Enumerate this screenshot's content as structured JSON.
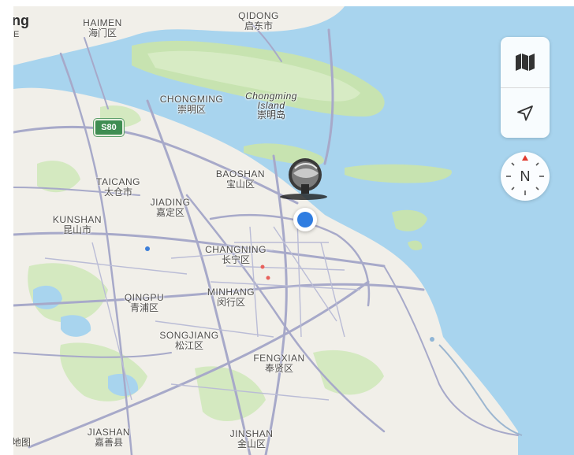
{
  "map": {
    "edge_text": "ng",
    "edge_sub": "E",
    "attribution": "地图",
    "highway_shield": "S80",
    "places": [
      {
        "en": "QIDONG",
        "zh": "启东市"
      },
      {
        "en": "HAIMEN",
        "zh": "海门区"
      },
      {
        "en": "CHONGMING",
        "zh": "崇明区"
      },
      {
        "en": "Chongming Island",
        "zh": "崇明岛"
      },
      {
        "en": "TAICANG",
        "zh": "太仓市"
      },
      {
        "en": "BAOSHAN",
        "zh": "宝山区"
      },
      {
        "en": "JIADING",
        "zh": "嘉定区"
      },
      {
        "en": "KUNSHAN",
        "zh": "昆山市"
      },
      {
        "en": "CHANGNING",
        "zh": "长宁区"
      },
      {
        "en": "QINGPU",
        "zh": "青浦区"
      },
      {
        "en": "MINHANG",
        "zh": "闵行区"
      },
      {
        "en": "SONGJIANG",
        "zh": "松江区"
      },
      {
        "en": "FENGXIAN",
        "zh": "奉贤区"
      },
      {
        "en": "JIASHAN",
        "zh": "嘉善县"
      },
      {
        "en": "JINSHAN",
        "zh": "金山区"
      }
    ]
  },
  "controls": {
    "map_mode_icon": "map-icon",
    "locate_icon": "location-arrow-icon",
    "compass_label": "N"
  },
  "colors": {
    "water": "#a8d4ee",
    "land": "#f1efe9",
    "park": "#c7e3b0",
    "road": "#a7a9c9",
    "user_location": "#2f7de1"
  }
}
